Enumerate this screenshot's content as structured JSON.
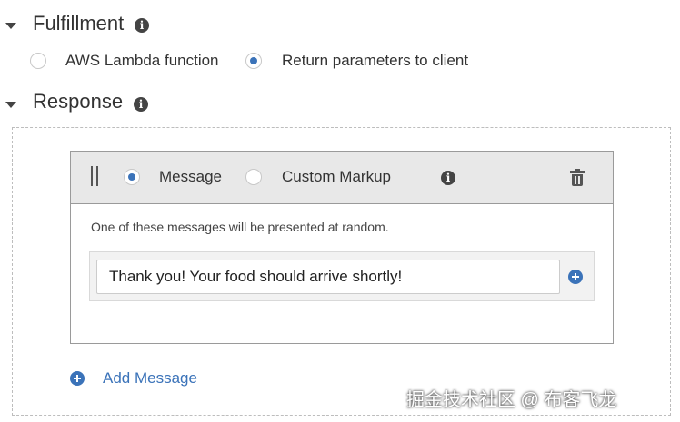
{
  "fulfillment": {
    "title": "Fulfillment",
    "options": [
      {
        "label": "AWS Lambda function",
        "selected": false
      },
      {
        "label": "Return parameters to client",
        "selected": true
      }
    ]
  },
  "response": {
    "title": "Response",
    "card": {
      "type_options": [
        {
          "label": "Message",
          "selected": true
        },
        {
          "label": "Custom Markup",
          "selected": false
        }
      ],
      "hint": "One of these messages will be presented at random.",
      "message_value": "Thank you! Your food should arrive shortly!"
    },
    "add_message_label": "Add Message"
  },
  "watermark": "掘金技术社区 @ 布客飞龙",
  "colors": {
    "accent": "#3b73b9",
    "header_bg": "#e8e8e8"
  },
  "icons": {
    "info": "info-icon",
    "trash": "trash-icon",
    "plus": "plus-circle-icon",
    "drag": "drag-handle-icon",
    "caret": "caret-down-icon"
  }
}
